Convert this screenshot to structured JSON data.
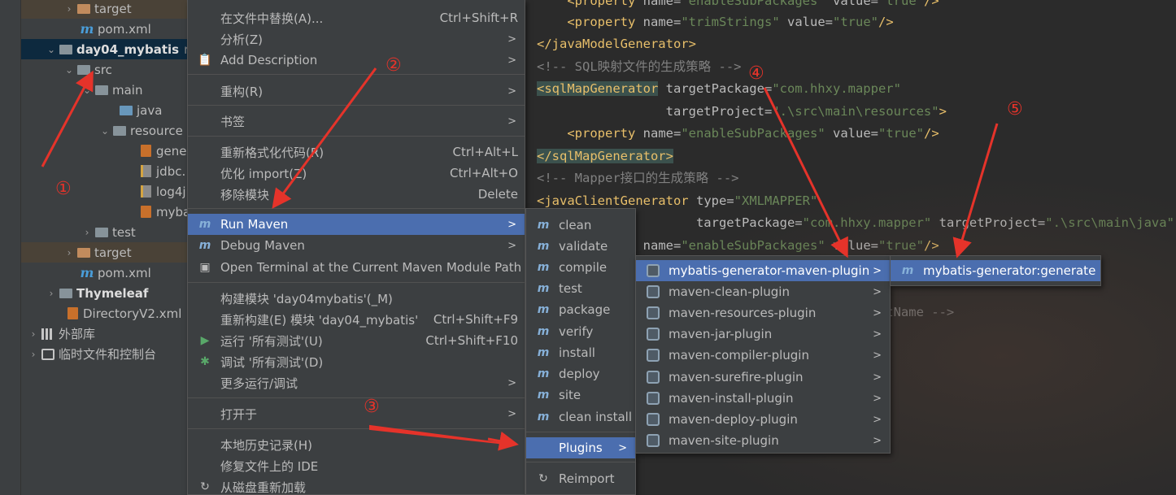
{
  "project_tree": {
    "rows": [
      {
        "name": "target",
        "type": "folder-orange",
        "expanded": false
      },
      {
        "name": "pom.xml",
        "type": "maven"
      },
      {
        "name": "day04_mybatis",
        "type": "module",
        "expanded": true,
        "suffix": "r"
      },
      {
        "name": "src",
        "type": "folder",
        "expanded": true
      },
      {
        "name": "main",
        "type": "folder",
        "expanded": true
      },
      {
        "name": "java",
        "type": "folder-blue"
      },
      {
        "name": "resource",
        "type": "folder-res",
        "expanded": true
      },
      {
        "name": "gene",
        "type": "xml"
      },
      {
        "name": "jdbc.",
        "type": "props"
      },
      {
        "name": "log4j",
        "type": "props"
      },
      {
        "name": "myba",
        "type": "xml"
      },
      {
        "name": "test",
        "type": "folder",
        "expanded": false
      },
      {
        "name": "target",
        "type": "folder-orange",
        "expanded": false
      },
      {
        "name": "pom.xml",
        "type": "maven"
      },
      {
        "name": "Thymeleaf",
        "type": "module",
        "expanded": false
      },
      {
        "name": "DirectoryV2.xml",
        "type": "xml"
      },
      {
        "name": "外部库",
        "type": "libs",
        "expanded": false
      },
      {
        "name": "临时文件和控制台",
        "type": "console",
        "expanded": false
      }
    ]
  },
  "context_menu": {
    "items": [
      {
        "label": "在文件中替换(A)...",
        "shortcut": "Ctrl+Shift+R"
      },
      {
        "label": "分析(Z)",
        "submenu": true
      },
      {
        "label": "Add Description",
        "submenu": true,
        "icon": "clipboard"
      },
      {
        "label": "重构(R)",
        "submenu": true
      },
      {
        "label": "书签",
        "submenu": true
      },
      {
        "label": "重新格式化代码(R)",
        "shortcut": "Ctrl+Alt+L"
      },
      {
        "label": "优化 import(Z)",
        "shortcut": "Ctrl+Alt+O"
      },
      {
        "label": "移除模块",
        "shortcut": "Delete"
      },
      {
        "label": "Run Maven",
        "submenu": true,
        "active": true,
        "icon": "maven"
      },
      {
        "label": "Debug Maven",
        "submenu": true,
        "icon": "maven"
      },
      {
        "label": "Open Terminal at the Current Maven Module Path",
        "icon": "terminal"
      },
      {
        "label": "构建模块 'day04mybatis'(_M)"
      },
      {
        "label": "重新构建(E) 模块 'day04_mybatis'",
        "shortcut": "Ctrl+Shift+F9"
      },
      {
        "label": "运行 '所有测试'(U)",
        "shortcut": "Ctrl+Shift+F10",
        "icon": "run"
      },
      {
        "label": "调试 '所有测试'(D)",
        "icon": "debug"
      },
      {
        "label": "更多运行/调试",
        "submenu": true
      },
      {
        "label": "打开于",
        "submenu": true
      },
      {
        "label": "本地历史记录(H)",
        "submenu": true
      },
      {
        "label": "修复文件上的 IDE"
      },
      {
        "label": "从磁盘重新加载",
        "icon": "reload"
      }
    ]
  },
  "maven_menu": {
    "items": [
      "clean",
      "validate",
      "compile",
      "test",
      "package",
      "verify",
      "install",
      "deploy",
      "site",
      "clean install"
    ],
    "plugins_label": "Plugins",
    "reimport_label": "Reimport"
  },
  "plugins_menu": {
    "items": [
      "mybatis-generator-maven-plugin",
      "maven-clean-plugin",
      "maven-resources-plugin",
      "maven-jar-plugin",
      "maven-compiler-plugin",
      "maven-surefire-plugin",
      "maven-install-plugin",
      "maven-deploy-plugin",
      "maven-site-plugin"
    ]
  },
  "goal_menu": {
    "items": [
      "mybatis-generator:generate"
    ]
  },
  "annotations": [
    "①",
    "②",
    "③",
    "④",
    "⑤"
  ],
  "colors": {
    "menu_bg": "#3c3f41",
    "menu_active": "#4b6eaf",
    "editor_bg": "#2b2b2b",
    "tag": "#e8bf6a",
    "value": "#6a8759",
    "comment": "#808080",
    "annotation_red": "#e5332a"
  }
}
